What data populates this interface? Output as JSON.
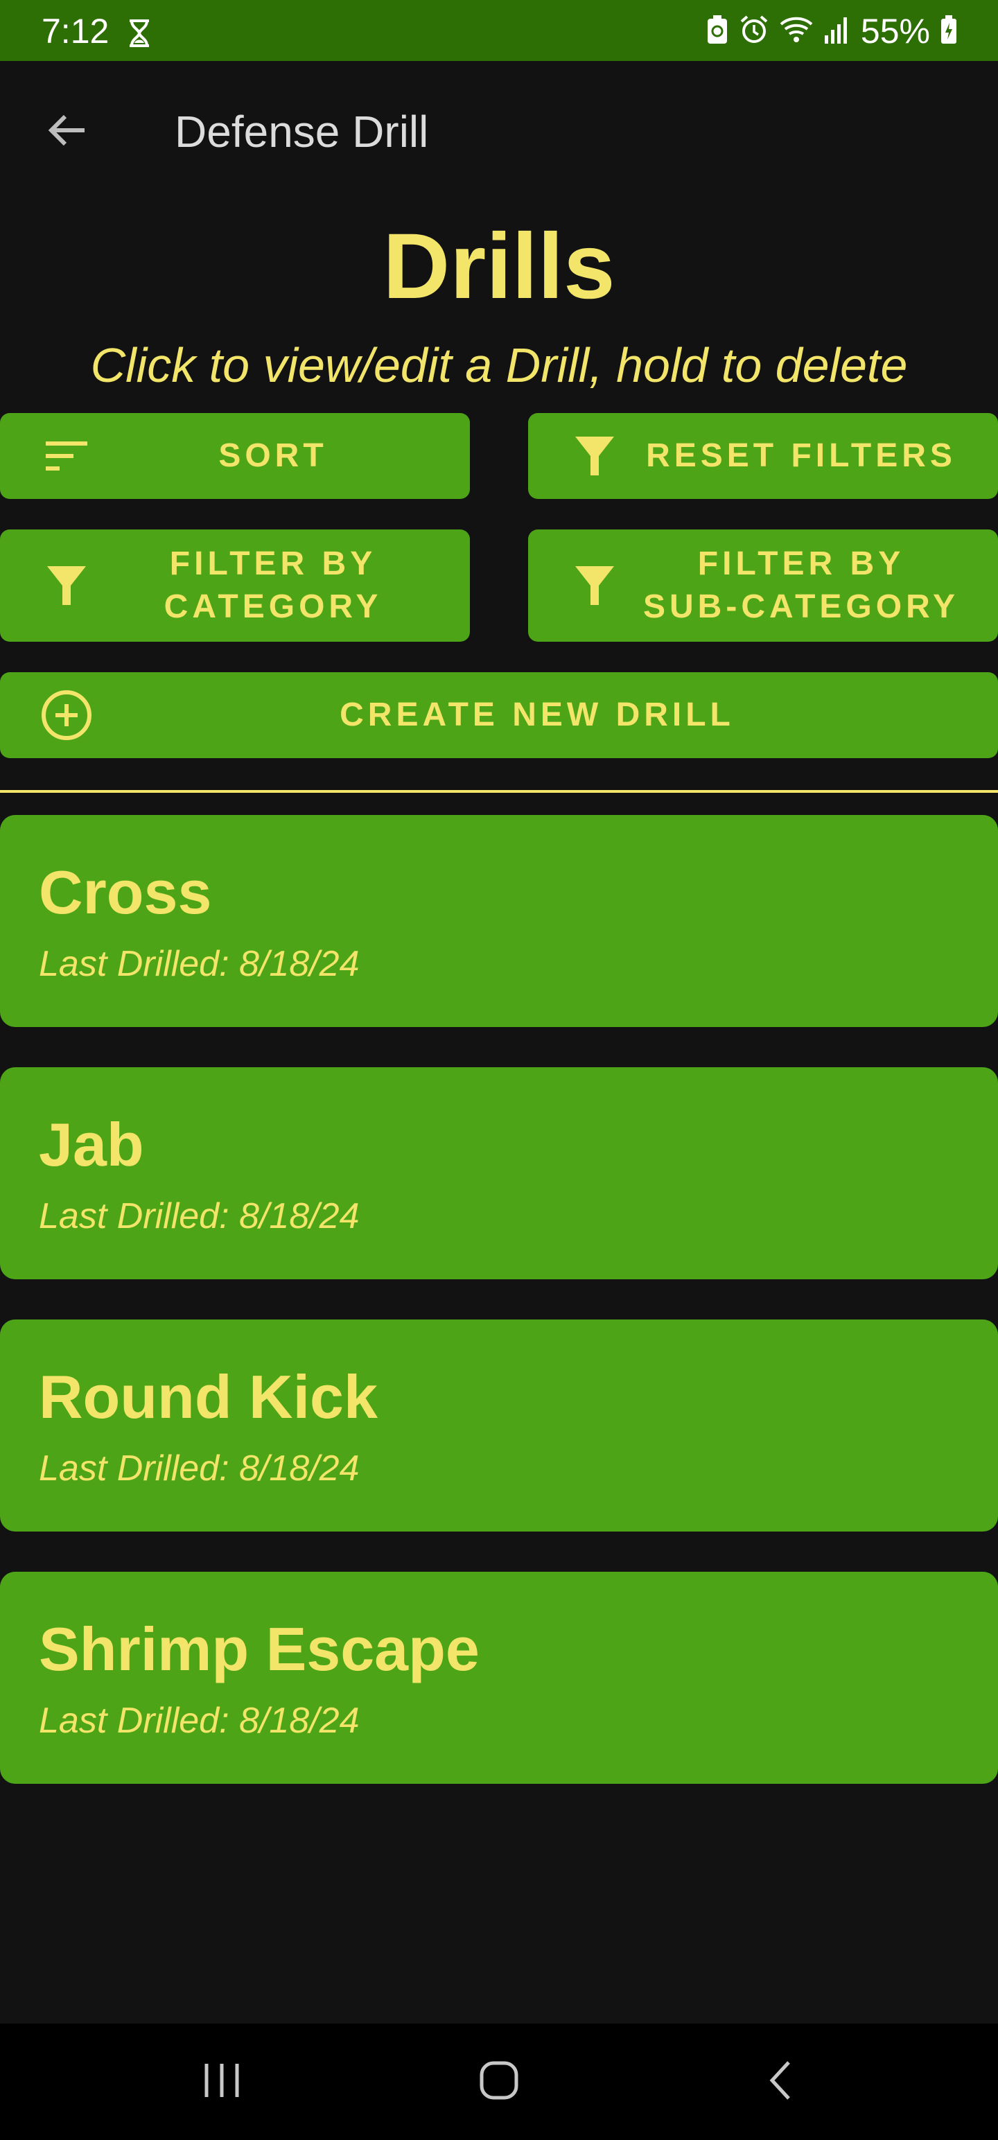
{
  "status_bar": {
    "time": "7:12",
    "battery": "55%"
  },
  "app_bar": {
    "title": "Defense Drill",
    "back_icon": "arrow-left-icon"
  },
  "header": {
    "title": "Drills",
    "subtitle": "Click to view/edit a Drill, hold to delete"
  },
  "buttons": {
    "sort": "SORT",
    "reset_filters": "RESET FILTERS",
    "filter_category": "FILTER BY\nCATEGORY",
    "filter_subcategory": "FILTER BY\nSUB-CATEGORY",
    "create_new": "CREATE NEW DRILL"
  },
  "drills": [
    {
      "name": "Cross",
      "last_drilled": "Last Drilled: 8/18/24"
    },
    {
      "name": "Jab",
      "last_drilled": "Last Drilled: 8/18/24"
    },
    {
      "name": "Round Kick",
      "last_drilled": "Last Drilled: 8/18/24"
    },
    {
      "name": "Shrimp Escape",
      "last_drilled": "Last Drilled: 8/18/24"
    }
  ],
  "colors": {
    "status_bar": "#2e6f05",
    "background": "#121212",
    "button": "#4ea417",
    "accent_text": "#f2e56a"
  }
}
